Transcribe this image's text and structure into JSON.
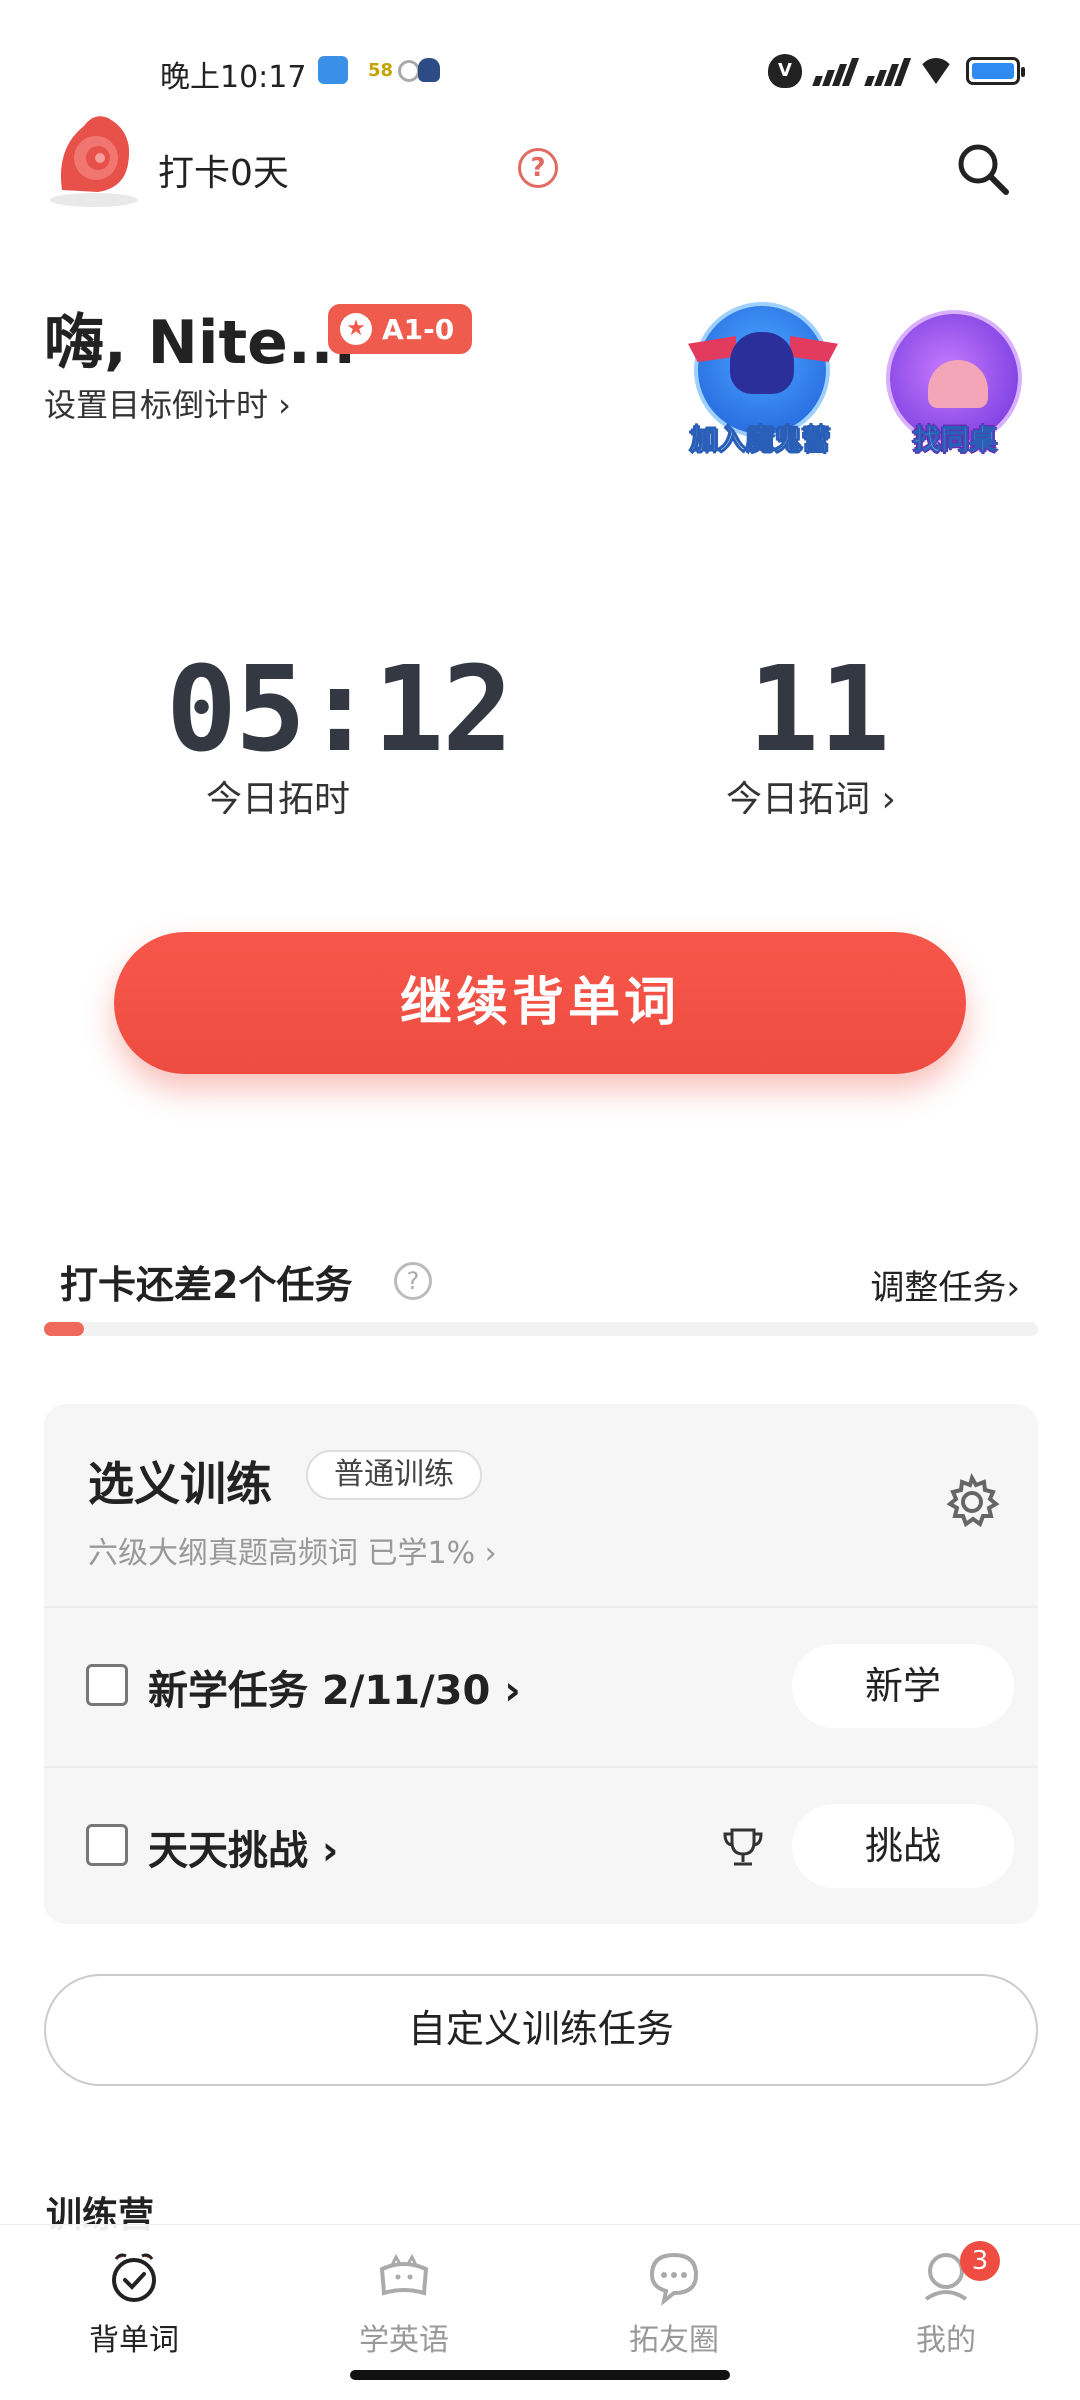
{
  "status_bar": {
    "time": "晚上10:17",
    "app_icon_text": "58"
  },
  "header": {
    "checkin_days": "打卡0天",
    "help": "?"
  },
  "profile": {
    "greeting": "嗨, Nite...",
    "level": "A1-0",
    "goal_link": "设置目标倒计时 ›"
  },
  "badges": {
    "join": "加入魔鬼营",
    "desk": "找同桌"
  },
  "stats": {
    "time_value": "05:12",
    "time_label": "今日拓时",
    "words_value": "11",
    "words_label": "今日拓词 ›"
  },
  "continue_button": "继续背单词",
  "tasks": {
    "title": "打卡还差2个任务",
    "help": "?",
    "adjust": "调整任务›",
    "progress": 0.04,
    "card": {
      "title": "选义训练",
      "tag": "普通训练",
      "subtitle": "六级大纲真题高频词  已学1% ›",
      "rows": [
        {
          "label": "新学任务 2/11/30 ›",
          "button": "新学"
        },
        {
          "label": "天天挑战 ›",
          "button": "挑战"
        }
      ]
    },
    "custom_button": "自定义训练任务"
  },
  "camp": {
    "title": "训练营"
  },
  "nav": {
    "items": [
      {
        "label": "背单词",
        "icon": "alarm-clock-check-icon",
        "active": true
      },
      {
        "label": "学英语",
        "icon": "book-cat-icon",
        "active": false
      },
      {
        "label": "拓友圈",
        "icon": "chat-bubble-icon",
        "active": false
      },
      {
        "label": "我的",
        "icon": "profile-icon",
        "active": false,
        "badge": "3"
      }
    ]
  },
  "colors": {
    "accent": "#ef4c40",
    "text": "#222222",
    "muted": "#999999"
  }
}
